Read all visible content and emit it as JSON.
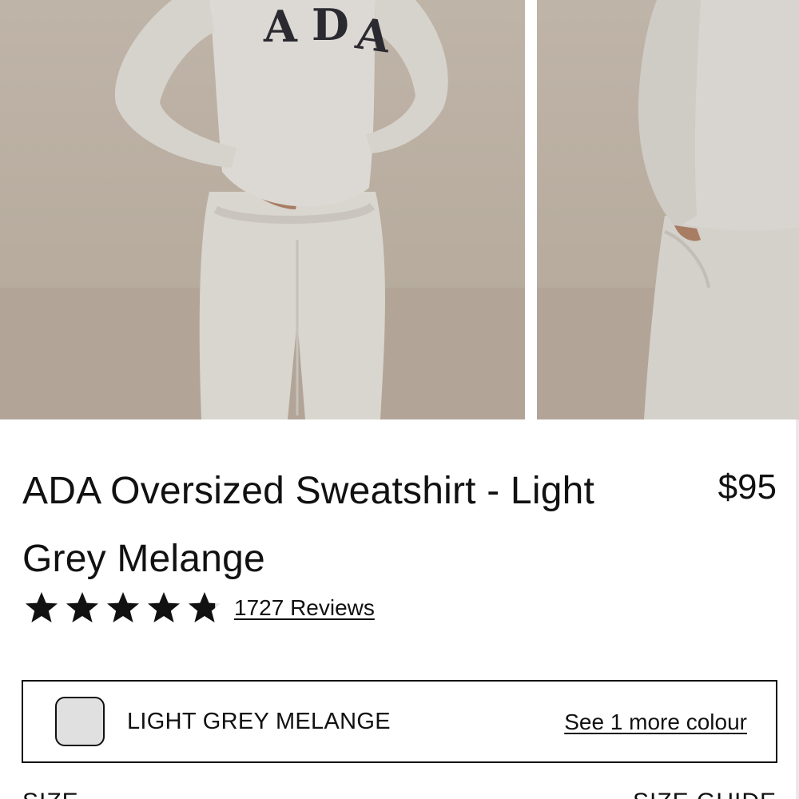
{
  "gallery": {
    "images": [
      {
        "alt": "Model wearing light grey oversized sweatshirt and sweatpants, back view",
        "print": "ADA"
      },
      {
        "alt": "Model wearing light grey sweatshirt and sweatpants, side view"
      }
    ]
  },
  "product": {
    "title": "ADA Oversized Sweatshirt - Light Grey Melange",
    "price": "$95",
    "rating": 4.8,
    "rating_max": 5,
    "reviews_label": "1727 Reviews"
  },
  "colour": {
    "selected_name": "LIGHT GREY MELANGE",
    "swatch_color": "#dfe0df",
    "more_label": "See 1 more colour"
  },
  "size": {
    "label": "SIZE",
    "guide_label": "SIZE GUIDE"
  },
  "icons": {
    "star": "star-icon"
  }
}
